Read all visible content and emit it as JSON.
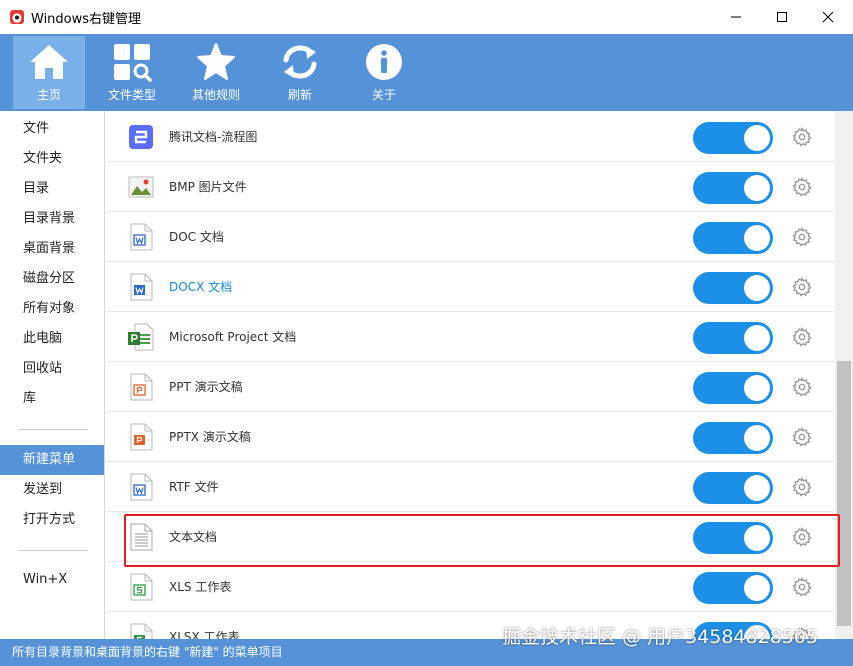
{
  "window": {
    "title": "Windows右键管理"
  },
  "toolbar": {
    "items": [
      {
        "label": "主页",
        "icon": "home-icon",
        "active": true
      },
      {
        "label": "文件类型",
        "icon": "file-type-icon",
        "active": false
      },
      {
        "label": "其他规则",
        "icon": "star-icon",
        "active": false
      },
      {
        "label": "刷新",
        "icon": "refresh-icon",
        "active": false
      },
      {
        "label": "关于",
        "icon": "info-icon",
        "active": false
      }
    ]
  },
  "sidebar": {
    "items": [
      {
        "label": "文件"
      },
      {
        "label": "文件夹"
      },
      {
        "label": "目录"
      },
      {
        "label": "目录背景"
      },
      {
        "label": "桌面背景"
      },
      {
        "label": "磁盘分区"
      },
      {
        "label": "所有对象"
      },
      {
        "label": "此电脑"
      },
      {
        "label": "回收站"
      },
      {
        "label": "库"
      },
      {
        "label": "新建菜单",
        "active": true
      },
      {
        "label": "发送到"
      },
      {
        "label": "打开方式"
      },
      {
        "label": "Win+X"
      }
    ]
  },
  "list": {
    "items": [
      {
        "name": "腾讯文档-流程图",
        "icon": "tencent-flowchart-icon",
        "enabled": true
      },
      {
        "name": "BMP 图片文件",
        "icon": "bmp-image-icon",
        "enabled": true
      },
      {
        "name": "DOC 文档",
        "icon": "doc-file-icon",
        "enabled": true
      },
      {
        "name": "DOCX 文档",
        "icon": "docx-file-icon",
        "enabled": true,
        "link": true
      },
      {
        "name": "Microsoft Project 文档",
        "icon": "project-file-icon",
        "enabled": true
      },
      {
        "name": "PPT 演示文稿",
        "icon": "ppt-file-icon",
        "enabled": true
      },
      {
        "name": "PPTX 演示文稿",
        "icon": "pptx-file-icon",
        "enabled": true
      },
      {
        "name": "RTF 文件",
        "icon": "rtf-file-icon",
        "enabled": true
      },
      {
        "name": "文本文档",
        "icon": "text-file-icon",
        "enabled": true
      },
      {
        "name": "XLS 工作表",
        "icon": "xls-file-icon",
        "enabled": true
      },
      {
        "name": "XLSX 工作表",
        "icon": "xlsx-file-icon",
        "enabled": true
      }
    ]
  },
  "statusbar": {
    "text": "所有目录背景和桌面背景的右键 \"新建\" 的菜单项目"
  },
  "watermark": "掘金技术社区 @ 用户3458482850​5",
  "colors": {
    "accent": "#5592d7",
    "toggle_on": "#1d8fe6",
    "highlight": "#e02020"
  }
}
